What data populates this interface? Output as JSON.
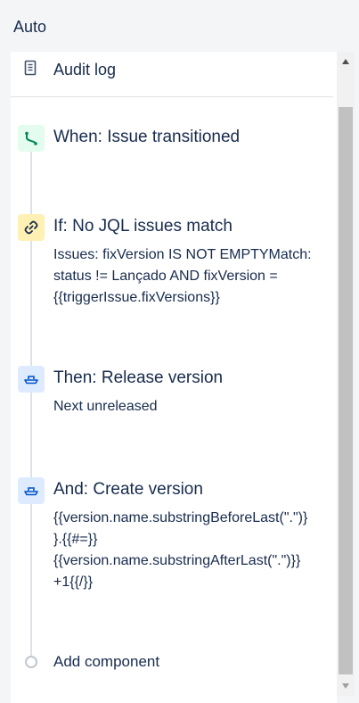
{
  "header": {
    "title": "Auto"
  },
  "audit": {
    "label": "Audit log",
    "icon": "document-icon"
  },
  "steps": [
    {
      "title": "When: Issue transitioned",
      "icon": "branch-icon",
      "icon_color": "#36b37e",
      "body": []
    },
    {
      "title": "If: No JQL issues match",
      "icon": "link-icon",
      "icon_color": "#ff991f",
      "body": [
        "Issues: fixVersion IS NOT EMPTYMatch:",
        "status != Lançado AND fixVersion =",
        "{{triggerIssue.fixVersions}}"
      ]
    },
    {
      "title": "Then: Release version",
      "icon": "ship-icon",
      "icon_color": "#0052cc",
      "body": [
        "Next unreleased"
      ]
    },
    {
      "title": "And: Create version",
      "icon": "ship-icon",
      "icon_color": "#0052cc",
      "body": [
        "{{version.name.substringBeforeLast(\".\")}",
        "}.{{#=}}",
        "{{version.name.substringAfterLast(\".\")}}",
        "+1{{/}}"
      ]
    }
  ],
  "add_component": {
    "label": "Add component"
  },
  "scrollbar": {
    "up_icon": "triangle-up-icon",
    "down_icon": "triangle-down-icon"
  }
}
